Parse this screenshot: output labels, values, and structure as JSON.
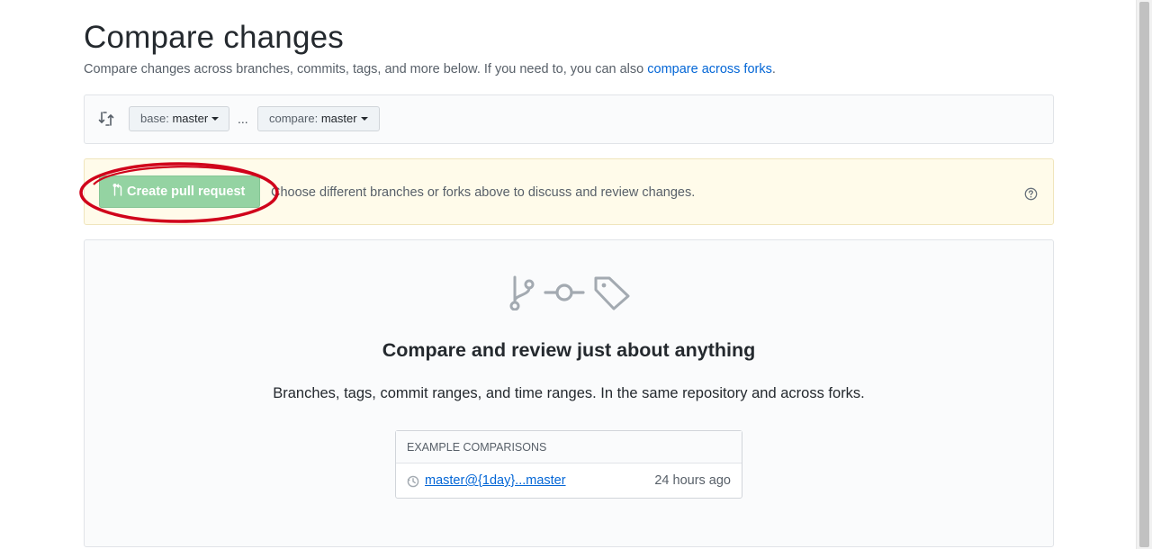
{
  "header": {
    "title": "Compare changes",
    "subtitle_text": "Compare changes across branches, commits, tags, and more below. If you need to, you can also ",
    "subtitle_link": "compare across forks",
    "subtitle_end": "."
  },
  "range": {
    "icon": "git-compare-icon",
    "base_label": "base:",
    "base_value": "master",
    "separator": "...",
    "compare_label": "compare:",
    "compare_value": "master"
  },
  "flash": {
    "create_pr_label": "Create pull request",
    "create_pr_icon": "git-pull-request-icon",
    "message": "Choose different branches or forks above to discuss and review changes.",
    "help_icon": "question-icon",
    "annotation_color": "#d0021b"
  },
  "blankslate": {
    "icons": [
      "git-branch-icon",
      "git-commit-icon",
      "tag-icon"
    ],
    "heading": "Compare and review just about anything",
    "description": "Branches, tags, commit ranges, and time ranges. In the same repository and across forks."
  },
  "examples": {
    "header": "EXAMPLE COMPARISONS",
    "items": [
      {
        "icon": "history-icon",
        "label": "master@{1day}...master",
        "time": "24 hours ago"
      }
    ]
  },
  "colors": {
    "link": "#0366d6",
    "pr_button_disabled": "#94d3a2",
    "flash_background": "#fffbea",
    "annotation": "#d0021b"
  }
}
